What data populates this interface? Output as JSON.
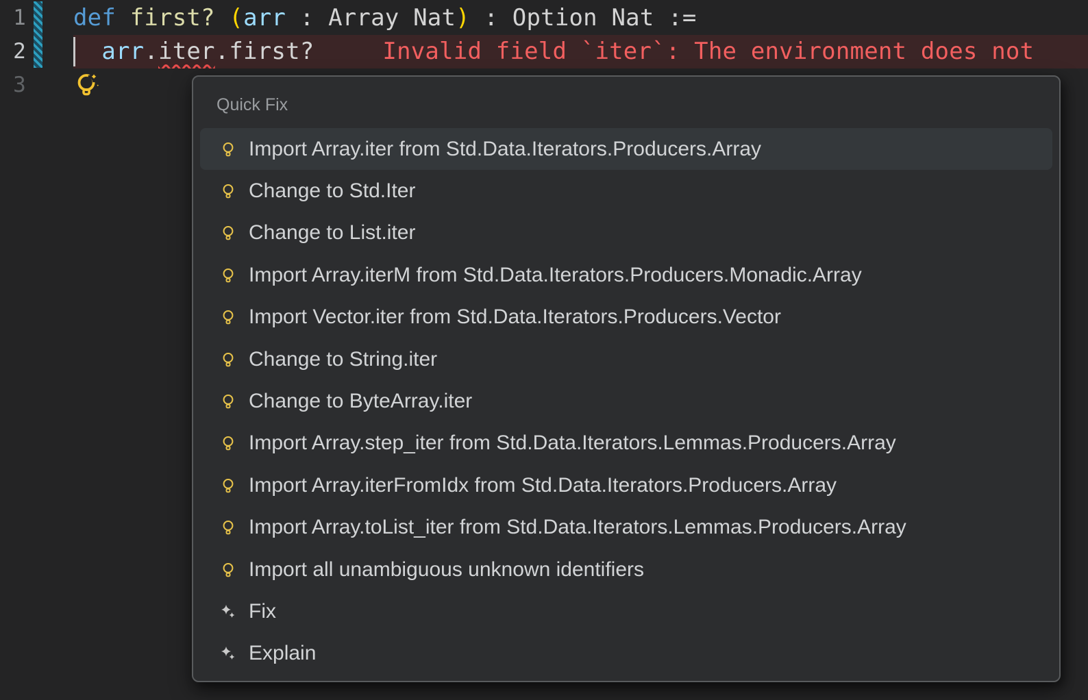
{
  "editor": {
    "lines": [
      {
        "number": "1",
        "tokens": [
          {
            "text": "def ",
            "color": "#569cd6"
          },
          {
            "text": "first?",
            "color": "#dcdcaa"
          },
          {
            "text": " ",
            "color": "#d4d4d4"
          },
          {
            "text": "(",
            "color": "#ffd602"
          },
          {
            "text": "arr",
            "color": "#9cdcfe"
          },
          {
            "text": " : Array Nat",
            "color": "#d4d4d4"
          },
          {
            "text": ")",
            "color": "#ffd602"
          },
          {
            "text": " : Option Nat :=",
            "color": "#d4d4d4"
          }
        ]
      },
      {
        "number": "2",
        "tokens": [
          {
            "text": "  arr",
            "color": "#9cdcfe"
          },
          {
            "text": ".",
            "color": "#d4d4d4"
          },
          {
            "text": "iter",
            "color": "#d4d4d4",
            "squiggle": true
          },
          {
            "text": ".first?",
            "color": "#d4d4d4"
          }
        ]
      },
      {
        "number": "3",
        "tokens": []
      }
    ],
    "error": {
      "message": "Invalid field `iter`: The environment does not",
      "text_color": "#f25f5f",
      "background_color": "#3b2526",
      "squiggle_color": "#e84b4b"
    },
    "git_indicator_color": "#2d9fc0",
    "lightbulb_color": "#f2c230"
  },
  "quick_fix_menu": {
    "header": "Quick Fix",
    "items": [
      {
        "label": "Import Array.iter from Std.Data.Iterators.Producers.Array",
        "icon": "lightbulb",
        "selected": true
      },
      {
        "label": "Change to Std.Iter",
        "icon": "lightbulb",
        "selected": false
      },
      {
        "label": "Change to List.iter",
        "icon": "lightbulb",
        "selected": false
      },
      {
        "label": "Import Array.iterM from Std.Data.Iterators.Producers.Monadic.Array",
        "icon": "lightbulb",
        "selected": false
      },
      {
        "label": "Import Vector.iter from Std.Data.Iterators.Producers.Vector",
        "icon": "lightbulb",
        "selected": false
      },
      {
        "label": "Change to String.iter",
        "icon": "lightbulb",
        "selected": false
      },
      {
        "label": "Change to ByteArray.iter",
        "icon": "lightbulb",
        "selected": false
      },
      {
        "label": "Import Array.step_iter from Std.Data.Iterators.Lemmas.Producers.Array",
        "icon": "lightbulb",
        "selected": false
      },
      {
        "label": "Import Array.iterFromIdx from Std.Data.Iterators.Producers.Array",
        "icon": "lightbulb",
        "selected": false
      },
      {
        "label": "Import Array.toList_iter from Std.Data.Iterators.Lemmas.Producers.Array",
        "icon": "lightbulb",
        "selected": false
      },
      {
        "label": "Import all unambiguous unknown identifiers",
        "icon": "lightbulb",
        "selected": false
      },
      {
        "label": "Fix",
        "icon": "sparkle",
        "selected": false
      },
      {
        "label": "Explain",
        "icon": "sparkle",
        "selected": false
      }
    ],
    "icon_colors": {
      "lightbulb": "#e8c34a",
      "sparkle": "#c9c9c9"
    }
  }
}
